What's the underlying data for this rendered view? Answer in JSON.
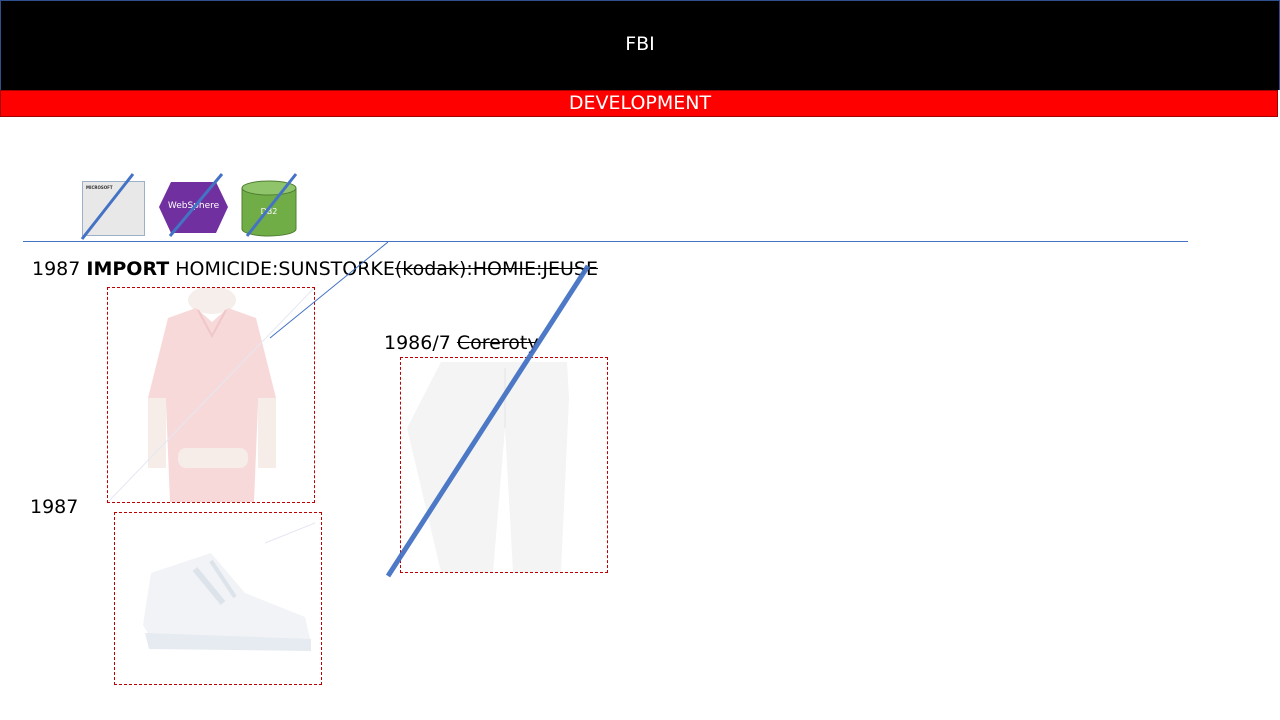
{
  "header": {
    "title": "FBI"
  },
  "banner": {
    "text": "DEVELOPMENT"
  },
  "logos": {
    "microsoft": "MICROSOFT",
    "websphere": "WebSphere",
    "db2": "DB2"
  },
  "timeline": {
    "line1": {
      "year": "1987",
      "keyword": "IMPORT",
      "plain": "HOMICIDE:SUNSTORKE",
      "struck": "(kodak):HOMIE:JEUSE"
    },
    "line2": {
      "year": "1986/7",
      "struck": "Coreroty"
    },
    "line3": {
      "year": "1987"
    }
  },
  "colors": {
    "header_bg": "#000000",
    "banner_bg": "#ff0000",
    "strike_line": "#4472c4",
    "frame_border": "#c00000"
  },
  "images": [
    "red-polo-shirt",
    "white-trousers",
    "white-sneaker"
  ]
}
